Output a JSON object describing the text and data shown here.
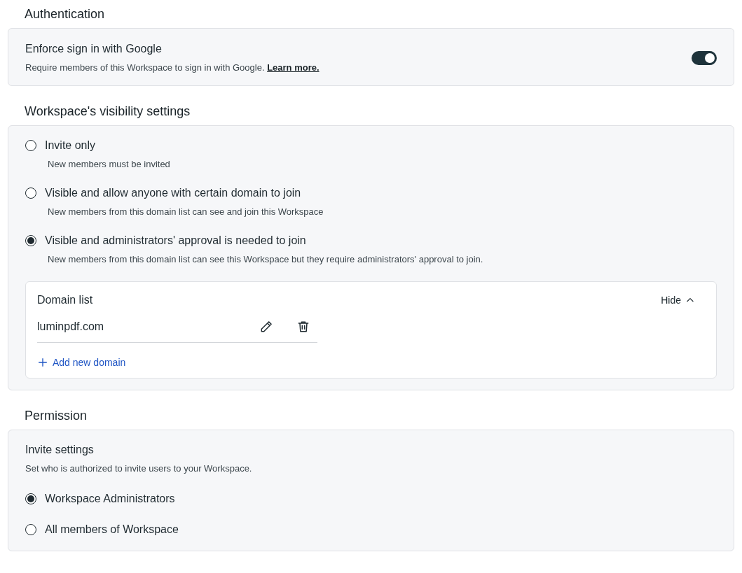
{
  "authentication": {
    "heading": "Authentication",
    "setting": {
      "title": "Enforce sign in with Google",
      "description": "Require members of this Workspace to sign in with Google.",
      "link": "Learn more.",
      "on": true
    }
  },
  "visibility": {
    "heading": "Workspace's visibility settings",
    "options": [
      {
        "label": "Invite only",
        "description": "New members must be invited",
        "selected": false
      },
      {
        "label": "Visible and allow anyone with certain domain to join",
        "description": "New members from this domain list can see and join this Workspace",
        "selected": false
      },
      {
        "label": "Visible and administrators' approval is needed to join",
        "description": "New members from this domain list can see this Workspace but they require administrators' approval to join.",
        "selected": true
      }
    ],
    "domain_list": {
      "title": "Domain list",
      "toggle_label": "Hide",
      "expanded": true,
      "domains": [
        "luminpdf.com"
      ],
      "add_label": "Add new domain"
    }
  },
  "permission": {
    "heading": "Permission",
    "title": "Invite settings",
    "description": "Set who is authorized to invite users to your Workspace.",
    "options": [
      {
        "label": "Workspace Administrators",
        "selected": true
      },
      {
        "label": "All members of Workspace",
        "selected": false
      }
    ]
  }
}
